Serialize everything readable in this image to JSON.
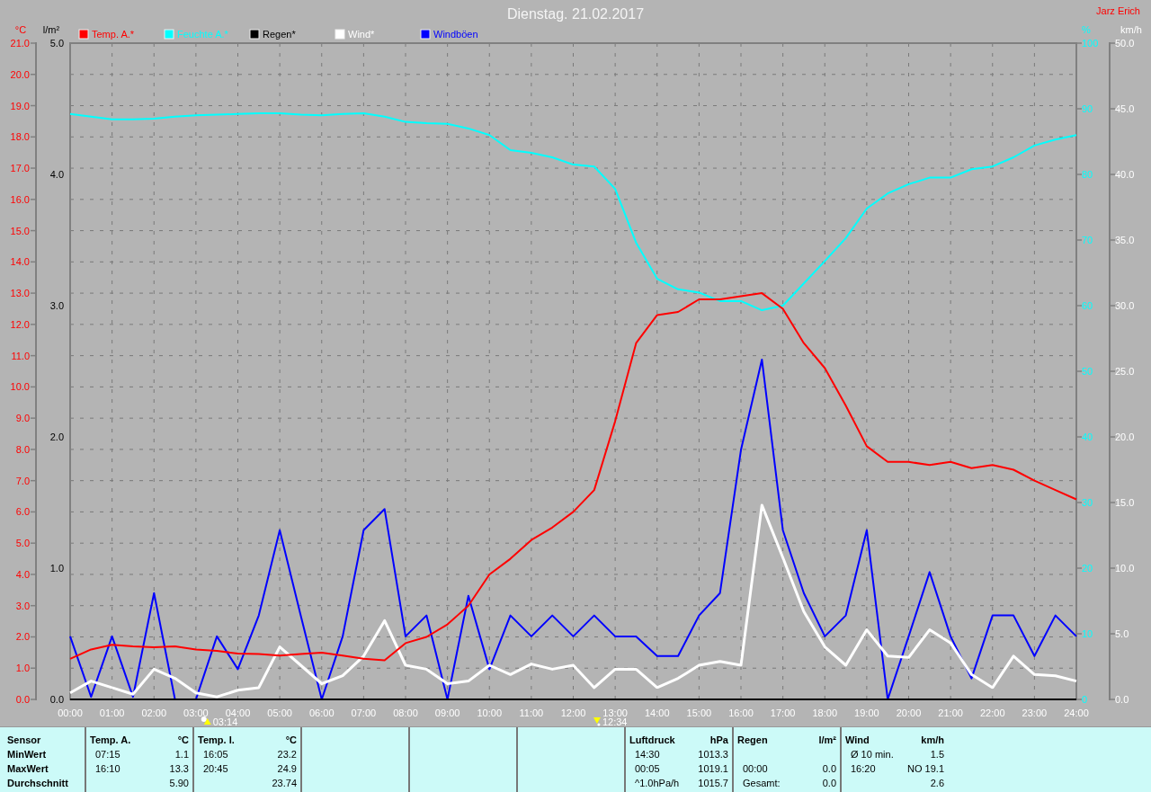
{
  "title": "Dienstag. 21.02.2017",
  "author": "Jarz Erich",
  "chart": {
    "chart_data": {
      "type": "line",
      "grid": true,
      "legend": "top",
      "xlim": [
        0,
        24
      ],
      "x": [
        0,
        0.5,
        1,
        1.5,
        2,
        2.5,
        3,
        3.5,
        4,
        4.5,
        5,
        5.5,
        6,
        6.5,
        7,
        7.5,
        8,
        8.5,
        9,
        9.5,
        10,
        10.5,
        11,
        11.5,
        12,
        12.5,
        13,
        13.5,
        14,
        14.5,
        15,
        15.5,
        16,
        16.5,
        17,
        17.5,
        18,
        18.5,
        19,
        19.5,
        20,
        20.5,
        21,
        21.5,
        22,
        22.5,
        23,
        23.5,
        24
      ],
      "xticks": [
        {
          "value": 0,
          "label": "00:00"
        },
        {
          "value": 1,
          "label": "01:00"
        },
        {
          "value": 2,
          "label": "02:00"
        },
        {
          "value": 3,
          "label": "03:00"
        },
        {
          "value": 4,
          "label": "04:00"
        },
        {
          "value": 5,
          "label": "05:00"
        },
        {
          "value": 6,
          "label": "06:00"
        },
        {
          "value": 7,
          "label": "07:00"
        },
        {
          "value": 8,
          "label": "08:00"
        },
        {
          "value": 9,
          "label": "09:00"
        },
        {
          "value": 10,
          "label": "10:00"
        },
        {
          "value": 11,
          "label": "11:00"
        },
        {
          "value": 12,
          "label": "12:00"
        },
        {
          "value": 13,
          "label": "13:00"
        },
        {
          "value": 14,
          "label": "14:00"
        },
        {
          "value": 15,
          "label": "15:00"
        },
        {
          "value": 16,
          "label": "16:00"
        },
        {
          "value": 17,
          "label": "17:00"
        },
        {
          "value": 18,
          "label": "18:00"
        },
        {
          "value": 19,
          "label": "19:00"
        },
        {
          "value": 20,
          "label": "20:00"
        },
        {
          "value": 21,
          "label": "21:00"
        },
        {
          "value": 22,
          "label": "22:00"
        },
        {
          "value": 23,
          "label": "23:00"
        },
        {
          "value": 24,
          "label": "24:00"
        }
      ],
      "ylabel": "°C",
      "ylim": [
        0,
        21
      ],
      "yticks": [
        {
          "value": 0,
          "label": "0.0"
        },
        {
          "value": 1,
          "label": "1.0"
        },
        {
          "value": 2,
          "label": "2.0"
        },
        {
          "value": 3,
          "label": "3.0"
        },
        {
          "value": 4,
          "label": "4.0"
        },
        {
          "value": 5,
          "label": "5.0"
        },
        {
          "value": 6,
          "label": "6.0"
        },
        {
          "value": 7,
          "label": "7.0"
        },
        {
          "value": 8,
          "label": "8.0"
        },
        {
          "value": 9,
          "label": "9.0"
        },
        {
          "value": 10,
          "label": "10.0"
        },
        {
          "value": 11,
          "label": "11.0"
        },
        {
          "value": 12,
          "label": "12.0"
        },
        {
          "value": 13,
          "label": "13.0"
        },
        {
          "value": 14,
          "label": "14.0"
        },
        {
          "value": 15,
          "label": "15.0"
        },
        {
          "value": 16,
          "label": "16.0"
        },
        {
          "value": 17,
          "label": "17.0"
        },
        {
          "value": 18,
          "label": "18.0"
        },
        {
          "value": 19,
          "label": "19.0"
        },
        {
          "value": 20,
          "label": "20.0"
        },
        {
          "value": 21,
          "label": "21.0"
        }
      ],
      "y2label": "%",
      "y2lim": [
        0,
        100
      ],
      "y2ticks": [
        {
          "value": 0,
          "label": "0"
        },
        {
          "value": 10,
          "label": "10"
        },
        {
          "value": 20,
          "label": "20"
        },
        {
          "value": 30,
          "label": "30"
        },
        {
          "value": 40,
          "label": "40"
        },
        {
          "value": 50,
          "label": "50"
        },
        {
          "value": 60,
          "label": "60"
        },
        {
          "value": 70,
          "label": "70"
        },
        {
          "value": 80,
          "label": "80"
        },
        {
          "value": 90,
          "label": "90"
        },
        {
          "value": 100,
          "label": "100"
        }
      ],
      "y3label": "km/h",
      "y3lim": [
        0,
        50
      ],
      "y3ticks": [
        {
          "value": 0,
          "label": "0.0"
        },
        {
          "value": 5,
          "label": "5.0"
        },
        {
          "value": 10,
          "label": "10.0"
        },
        {
          "value": 15,
          "label": "15.0"
        },
        {
          "value": 20,
          "label": "20.0"
        },
        {
          "value": 25,
          "label": "25.0"
        },
        {
          "value": 30,
          "label": "30.0"
        },
        {
          "value": 35,
          "label": "35.0"
        },
        {
          "value": 40,
          "label": "40.0"
        },
        {
          "value": 45,
          "label": "45.0"
        },
        {
          "value": 50,
          "label": "50.0"
        }
      ],
      "series": [
        {
          "name": "Temp. A.*",
          "color": "#ff0000",
          "values": [
            1.3,
            1.6,
            1.75,
            1.7,
            1.67,
            1.7,
            1.6,
            1.55,
            1.47,
            1.45,
            1.4,
            1.45,
            1.5,
            1.4,
            1.3,
            1.25,
            1.8,
            2.0,
            2.4,
            3.0,
            4.0,
            4.5,
            5.1,
            5.5,
            6.0,
            6.7,
            8.9,
            11.4,
            12.3,
            12.4,
            12.8,
            12.8,
            12.9,
            13.0,
            12.5,
            11.4,
            10.6,
            9.4,
            8.1,
            7.6,
            7.6,
            7.5,
            7.6,
            7.4,
            7.5,
            7.35,
            7.0,
            6.7,
            6.4
          ]
        },
        {
          "name": "Feuchte A.*",
          "color": "#00ffff",
          "axis": "y2",
          "values": [
            89.2,
            88.8,
            88.4,
            88.4,
            88.5,
            88.8,
            89,
            89.1,
            89.2,
            89.3,
            89.3,
            89.1,
            89,
            89.2,
            89.3,
            88.8,
            88,
            87.8,
            87.7,
            87,
            86,
            83.7,
            83.3,
            82.6,
            81.5,
            81.2,
            77.8,
            69.6,
            64.1,
            62.5,
            62,
            60.7,
            60.7,
            59.3,
            60,
            63.4,
            66.8,
            70.3,
            74.8,
            77.1,
            78.5,
            79.5,
            79.5,
            80.8,
            81.2,
            82.6,
            84.4,
            85.3,
            86
          ]
        },
        {
          "name": "Regen*",
          "color": "#000000",
          "values": [
            0,
            0,
            0,
            0,
            0,
            0,
            0,
            0,
            0,
            0,
            0,
            0,
            0,
            0,
            0,
            0,
            0,
            0,
            0,
            0,
            0,
            0,
            0,
            0,
            0,
            0,
            0,
            0,
            0,
            0,
            0,
            0,
            0,
            0,
            0,
            0,
            0,
            0,
            0,
            0,
            0,
            0,
            0,
            0,
            0,
            0,
            0,
            0,
            0
          ]
        },
        {
          "name": "Wind*",
          "color": "#ffffff",
          "axis": "y3",
          "values": [
            0.5,
            1.4,
            0.9,
            0.4,
            2.3,
            1.6,
            0.5,
            0.2,
            0.7,
            0.9,
            4.0,
            2.6,
            1.2,
            1.8,
            3.3,
            6.0,
            2.6,
            2.3,
            1.2,
            1.4,
            2.6,
            1.9,
            2.7,
            2.3,
            2.6,
            0.9,
            2.3,
            2.3,
            0.9,
            1.6,
            2.6,
            2.9,
            2.6,
            14.8,
            10.8,
            6.7,
            4.0,
            2.6,
            5.3,
            3.3,
            3.2,
            5.3,
            4.3,
            1.9,
            0.9,
            3.3,
            1.9,
            1.8,
            1.4
          ]
        },
        {
          "name": "Windböen",
          "color": "#0000ff",
          "axis": "y3",
          "values": [
            4.8,
            0.2,
            4.8,
            0.2,
            8.1,
            0,
            0,
            4.8,
            2.3,
            6.4,
            12.9,
            6.4,
            0,
            4.8,
            12.9,
            14.5,
            4.8,
            6.4,
            0,
            7.9,
            2.3,
            6.4,
            4.8,
            6.4,
            4.8,
            6.4,
            4.8,
            4.8,
            3.3,
            3.3,
            6.4,
            8.1,
            19.0,
            25.9,
            12.9,
            8.1,
            4.8,
            6.4,
            12.9,
            0,
            4.8,
            9.7,
            4.8,
            1.6,
            6.4,
            6.4,
            3.3,
            6.4,
            4.8
          ]
        }
      ]
    },
    "rain_axis": {
      "label": "l/m²",
      "ticks": [
        "5.0",
        "4.0",
        "3.0",
        "2.0",
        "1.0",
        "0.0"
      ]
    },
    "markers": [
      {
        "kind": "rise",
        "time": "03:14"
      },
      {
        "kind": "set",
        "time": "12:34"
      }
    ]
  },
  "stats": {
    "row_labels": [
      "Sensor",
      "MinWert",
      "MaxWert",
      "Durchschnitt"
    ],
    "panels": [
      {
        "kind": "data",
        "title": "Temp. A.",
        "unit": "°C",
        "min": {
          "time": "07:15",
          "value": "1.1"
        },
        "max": {
          "time": "16:10",
          "value": "13.3"
        },
        "avg": {
          "value": "5.90"
        }
      },
      {
        "kind": "data",
        "title": "Temp. I.",
        "unit": "°C",
        "min": {
          "time": "16:05",
          "value": "23.2"
        },
        "max": {
          "time": "20:45",
          "value": "24.9"
        },
        "avg": {
          "value": "23.74"
        }
      },
      {
        "kind": "blank"
      },
      {
        "kind": "blank"
      },
      {
        "kind": "blank"
      },
      {
        "kind": "data",
        "title": "Luftdruck",
        "unit": "hPa",
        "min": {
          "time": "14:30",
          "value": "1013.3"
        },
        "max": {
          "time": "00:05",
          "value": "1019.1"
        },
        "avg": {
          "time": "^1.0hPa/h",
          "value": "1015.7"
        }
      },
      {
        "kind": "data",
        "title": "Regen",
        "unit": "l/m²",
        "max": {
          "time": "00:00",
          "value": "0.0"
        },
        "avg": {
          "time": "Gesamt:",
          "value": "0.0"
        }
      },
      {
        "kind": "data",
        "title": "Wind",
        "unit": "km/h",
        "min": {
          "time": "Ø 10 min.",
          "value": "1.5"
        },
        "max": {
          "time": "16:20",
          "value": "NO 19.1"
        },
        "avg": {
          "value": "2.6"
        }
      }
    ]
  }
}
